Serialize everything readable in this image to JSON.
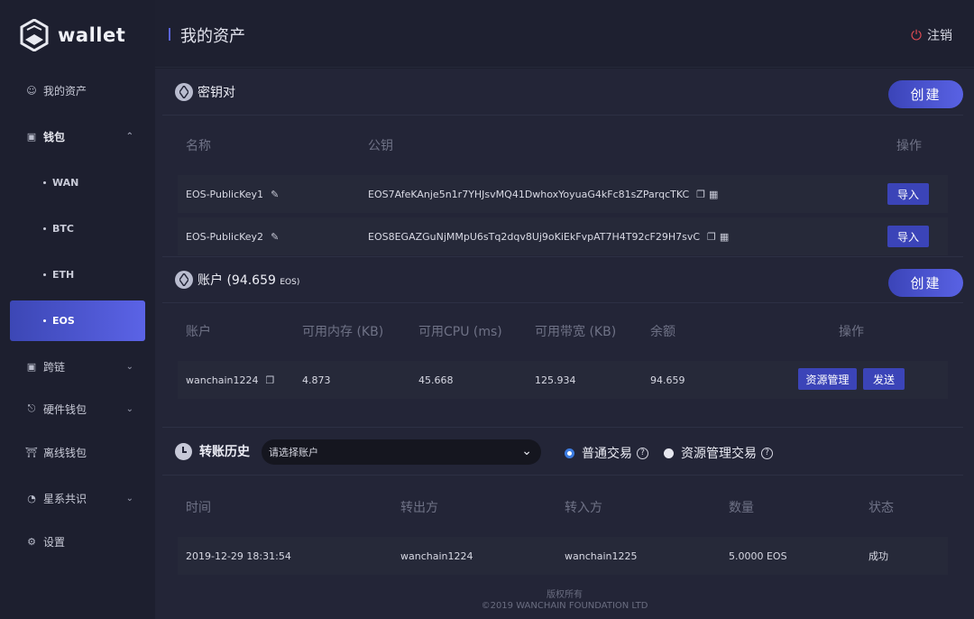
{
  "app": {
    "logo_text": "wallet"
  },
  "sidebar": {
    "items": [
      {
        "label": "我的资产",
        "icon": "user-icon"
      },
      {
        "label": "钱包",
        "icon": "wallet-icon"
      },
      {
        "label": "跨链",
        "icon": "cross-chain-icon"
      },
      {
        "label": "硬件钱包",
        "icon": "hardware-icon"
      },
      {
        "label": "离线钱包",
        "icon": "offline-icon"
      },
      {
        "label": "星系共识",
        "icon": "galaxy-icon"
      },
      {
        "label": "设置",
        "icon": "gear-icon"
      }
    ],
    "wallet_sub": [
      "WAN",
      "BTC",
      "ETH",
      "EOS"
    ],
    "active_sub": "EOS"
  },
  "header": {
    "title": "我的资产",
    "logout_label": "注销"
  },
  "keypair": {
    "title": "密钥对",
    "create_label": "创建",
    "columns": [
      "名称",
      "公钥",
      "操作"
    ],
    "rows": [
      {
        "name": "EOS-PublicKey1",
        "key": "EOS7AfeKAnje5n1r7YHJsvMQ41DwhoxYoyuaG4kFc81sZParqcTKC",
        "action": "导入"
      },
      {
        "name": "EOS-PublicKey2",
        "key": "EOS8EGAZGuNjMMpU6sTq2dqv8Uj9oKiEkFvpAT7H4T92cF29H7svC",
        "action": "导入"
      }
    ]
  },
  "account": {
    "title": "账户",
    "balance_value": "(94.659",
    "balance_unit": "EOS)",
    "create_label": "创建",
    "columns": [
      "账户",
      "可用内存 (KB)",
      "可用CPU (ms)",
      "可用带宽 (KB)",
      "余额",
      "操作"
    ],
    "rows": [
      {
        "account": "wanchain1224",
        "ram": "4.873",
        "cpu": "45.668",
        "net": "125.934",
        "balance": "94.659",
        "action1": "资源管理",
        "action2": "发送"
      }
    ]
  },
  "history": {
    "title": "转账历史",
    "select_placeholder": "请选择账户",
    "radio_normal": "普通交易",
    "radio_resource": "资源管理交易",
    "columns": [
      "时间",
      "转出方",
      "转入方",
      "数量",
      "状态"
    ],
    "rows": [
      {
        "time": "2019-12-29 18:31:54",
        "from": "wanchain1224",
        "to": "wanchain1225",
        "amount": "5.0000 EOS",
        "status": "成功"
      }
    ]
  },
  "footer": {
    "line1": "版权所有",
    "line2": "©2019 WANCHAIN FOUNDATION LTD"
  },
  "colors": {
    "accent": "#4a53d0",
    "sidebar_bg": "#1d1f2f",
    "panel_bg": "#232537",
    "power": "#e04b53"
  }
}
